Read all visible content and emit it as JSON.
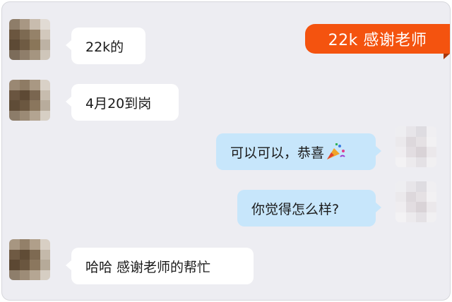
{
  "badge": {
    "text": "22k  感谢老师"
  },
  "colors": {
    "chat_background": "#ededf2",
    "incoming_bubble": "#ffffff",
    "outgoing_bubble": "#c7e6fb",
    "badge": "#f4530f"
  },
  "messages": [
    {
      "side": "incoming",
      "text": "22k的"
    },
    {
      "side": "incoming",
      "text": "4月20到岗"
    },
    {
      "side": "outgoing",
      "text": "可以可以，恭喜",
      "emoji": "party-popper-icon"
    },
    {
      "side": "outgoing",
      "text": "你觉得怎么样?"
    },
    {
      "side": "incoming",
      "text": "哈哈 感谢老师的帮忙"
    }
  ]
}
